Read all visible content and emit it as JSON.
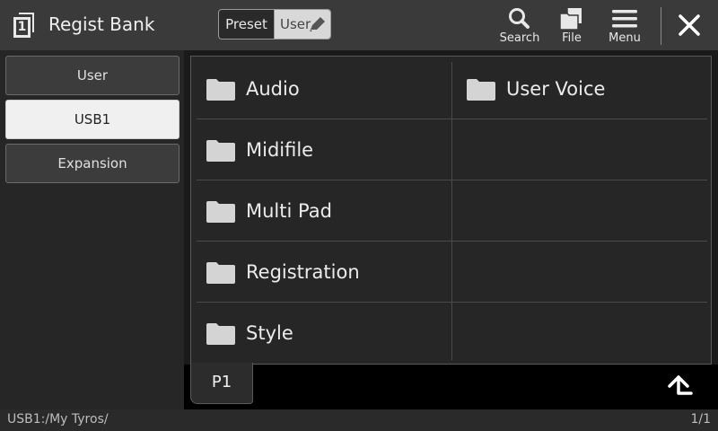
{
  "header": {
    "title": "Regist Bank",
    "app_icon_badge": "1",
    "toggle": {
      "preset": "Preset",
      "user": "User"
    },
    "search_label": "Search",
    "file_label": "File",
    "menu_label": "Menu"
  },
  "sidebar": {
    "items": [
      {
        "label": "User"
      },
      {
        "label": "USB1"
      },
      {
        "label": "Expansion"
      }
    ],
    "active": "USB1"
  },
  "files": {
    "left": [
      {
        "label": "Audio"
      },
      {
        "label": "Midifile"
      },
      {
        "label": "Multi Pad"
      },
      {
        "label": "Registration"
      },
      {
        "label": "Style"
      }
    ],
    "right": [
      {
        "label": "User Voice"
      }
    ]
  },
  "pager": {
    "tab": "P1"
  },
  "status": {
    "path": "USB1:/My Tyros/",
    "page": "1/1"
  },
  "colors": {
    "header_bg": "#3a3a3a",
    "active_tab_bg": "#f0f0f0",
    "folder": "#d4d4d4"
  },
  "icons": {
    "app": "regist-bank-icon",
    "search": "search-icon",
    "file": "file-icon",
    "menu": "menu-icon",
    "close": "close-icon",
    "edit": "pencil-icon",
    "folder": "folder-icon",
    "up": "up-folder-icon"
  }
}
